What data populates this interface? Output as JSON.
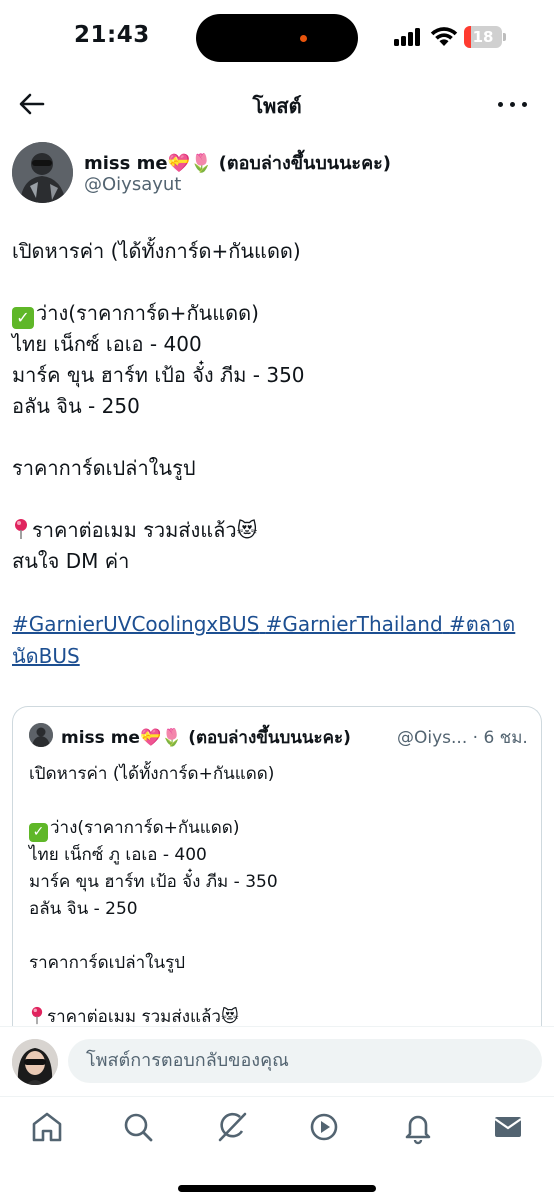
{
  "status_bar": {
    "time": "21:43",
    "battery_level": "18",
    "battery_fraction": 0.18,
    "icons": [
      "cellular-signal-icon",
      "wifi-icon",
      "battery-icon"
    ]
  },
  "header": {
    "title": "โพสต์",
    "back_icon": "arrow-left-icon",
    "more_icon": "more-dots-icon"
  },
  "post": {
    "author": {
      "name": "miss me💝🌷 (ตอบล่างขึ้นบนนะคะ)",
      "handle": "@Oiysayut"
    },
    "lines": {
      "l1": "เปิดหารค่า (ได้ทั้งการ์ด+กันแดด)",
      "l2": "ว่าง(ราคาการ์ด+กันแดด)",
      "l3": "ไทย เน็กซ์  เอเอ - 400",
      "l4": "มาร์ค ขุน ฮาร์ท เป้อ จั๋ง ภีม - 350",
      "l5": "อลัน จิน - 250",
      "l6": "ราคาการ์ดเปล่าในรูป",
      "l7": "ราคาต่อเมม รวมส่งแล้ว😻",
      "l8": "สนใจ DM ค่า"
    },
    "hashtags": {
      "h1": "#GarnierUVCoolingxBUS",
      "h2": "#GarnierThailand",
      "h3a": "#ตลาด",
      "h3b": "นัดBUS"
    }
  },
  "quote": {
    "name": "miss me💝🌷 (ตอบล่างขึ้นบนนะคะ)",
    "handle_time": "@Oiys... · 6 ชม.",
    "lines": {
      "l1": "เปิดหารค่า (ได้ทั้งการ์ด+กันแดด)",
      "l2": "ว่าง(ราคาการ์ด+กันแดด)",
      "l3": "ไทย เน็กซ์ ภู เอเอ - 400",
      "l4": "มาร์ค ขุน ฮาร์ท เป้อ จั๋ง ภีม - 350",
      "l5": "อลัน จิน - 250",
      "l6": "ราคาการ์ดเปล่าในรูป",
      "l7": "ราคาต่อเมม รวมส่งแล้ว😻"
    }
  },
  "reply": {
    "placeholder": "โพสต์การตอบกลับของคุณ"
  },
  "tab_bar": {
    "tabs": [
      "home-icon",
      "search-icon",
      "grok-icon",
      "video-icon",
      "notifications-icon",
      "messages-icon"
    ]
  },
  "colors": {
    "text": "#0f1419",
    "secondary": "#536471",
    "link": "#1d4f91",
    "check": "#5fb728",
    "battery_low": "#ff3b30"
  }
}
